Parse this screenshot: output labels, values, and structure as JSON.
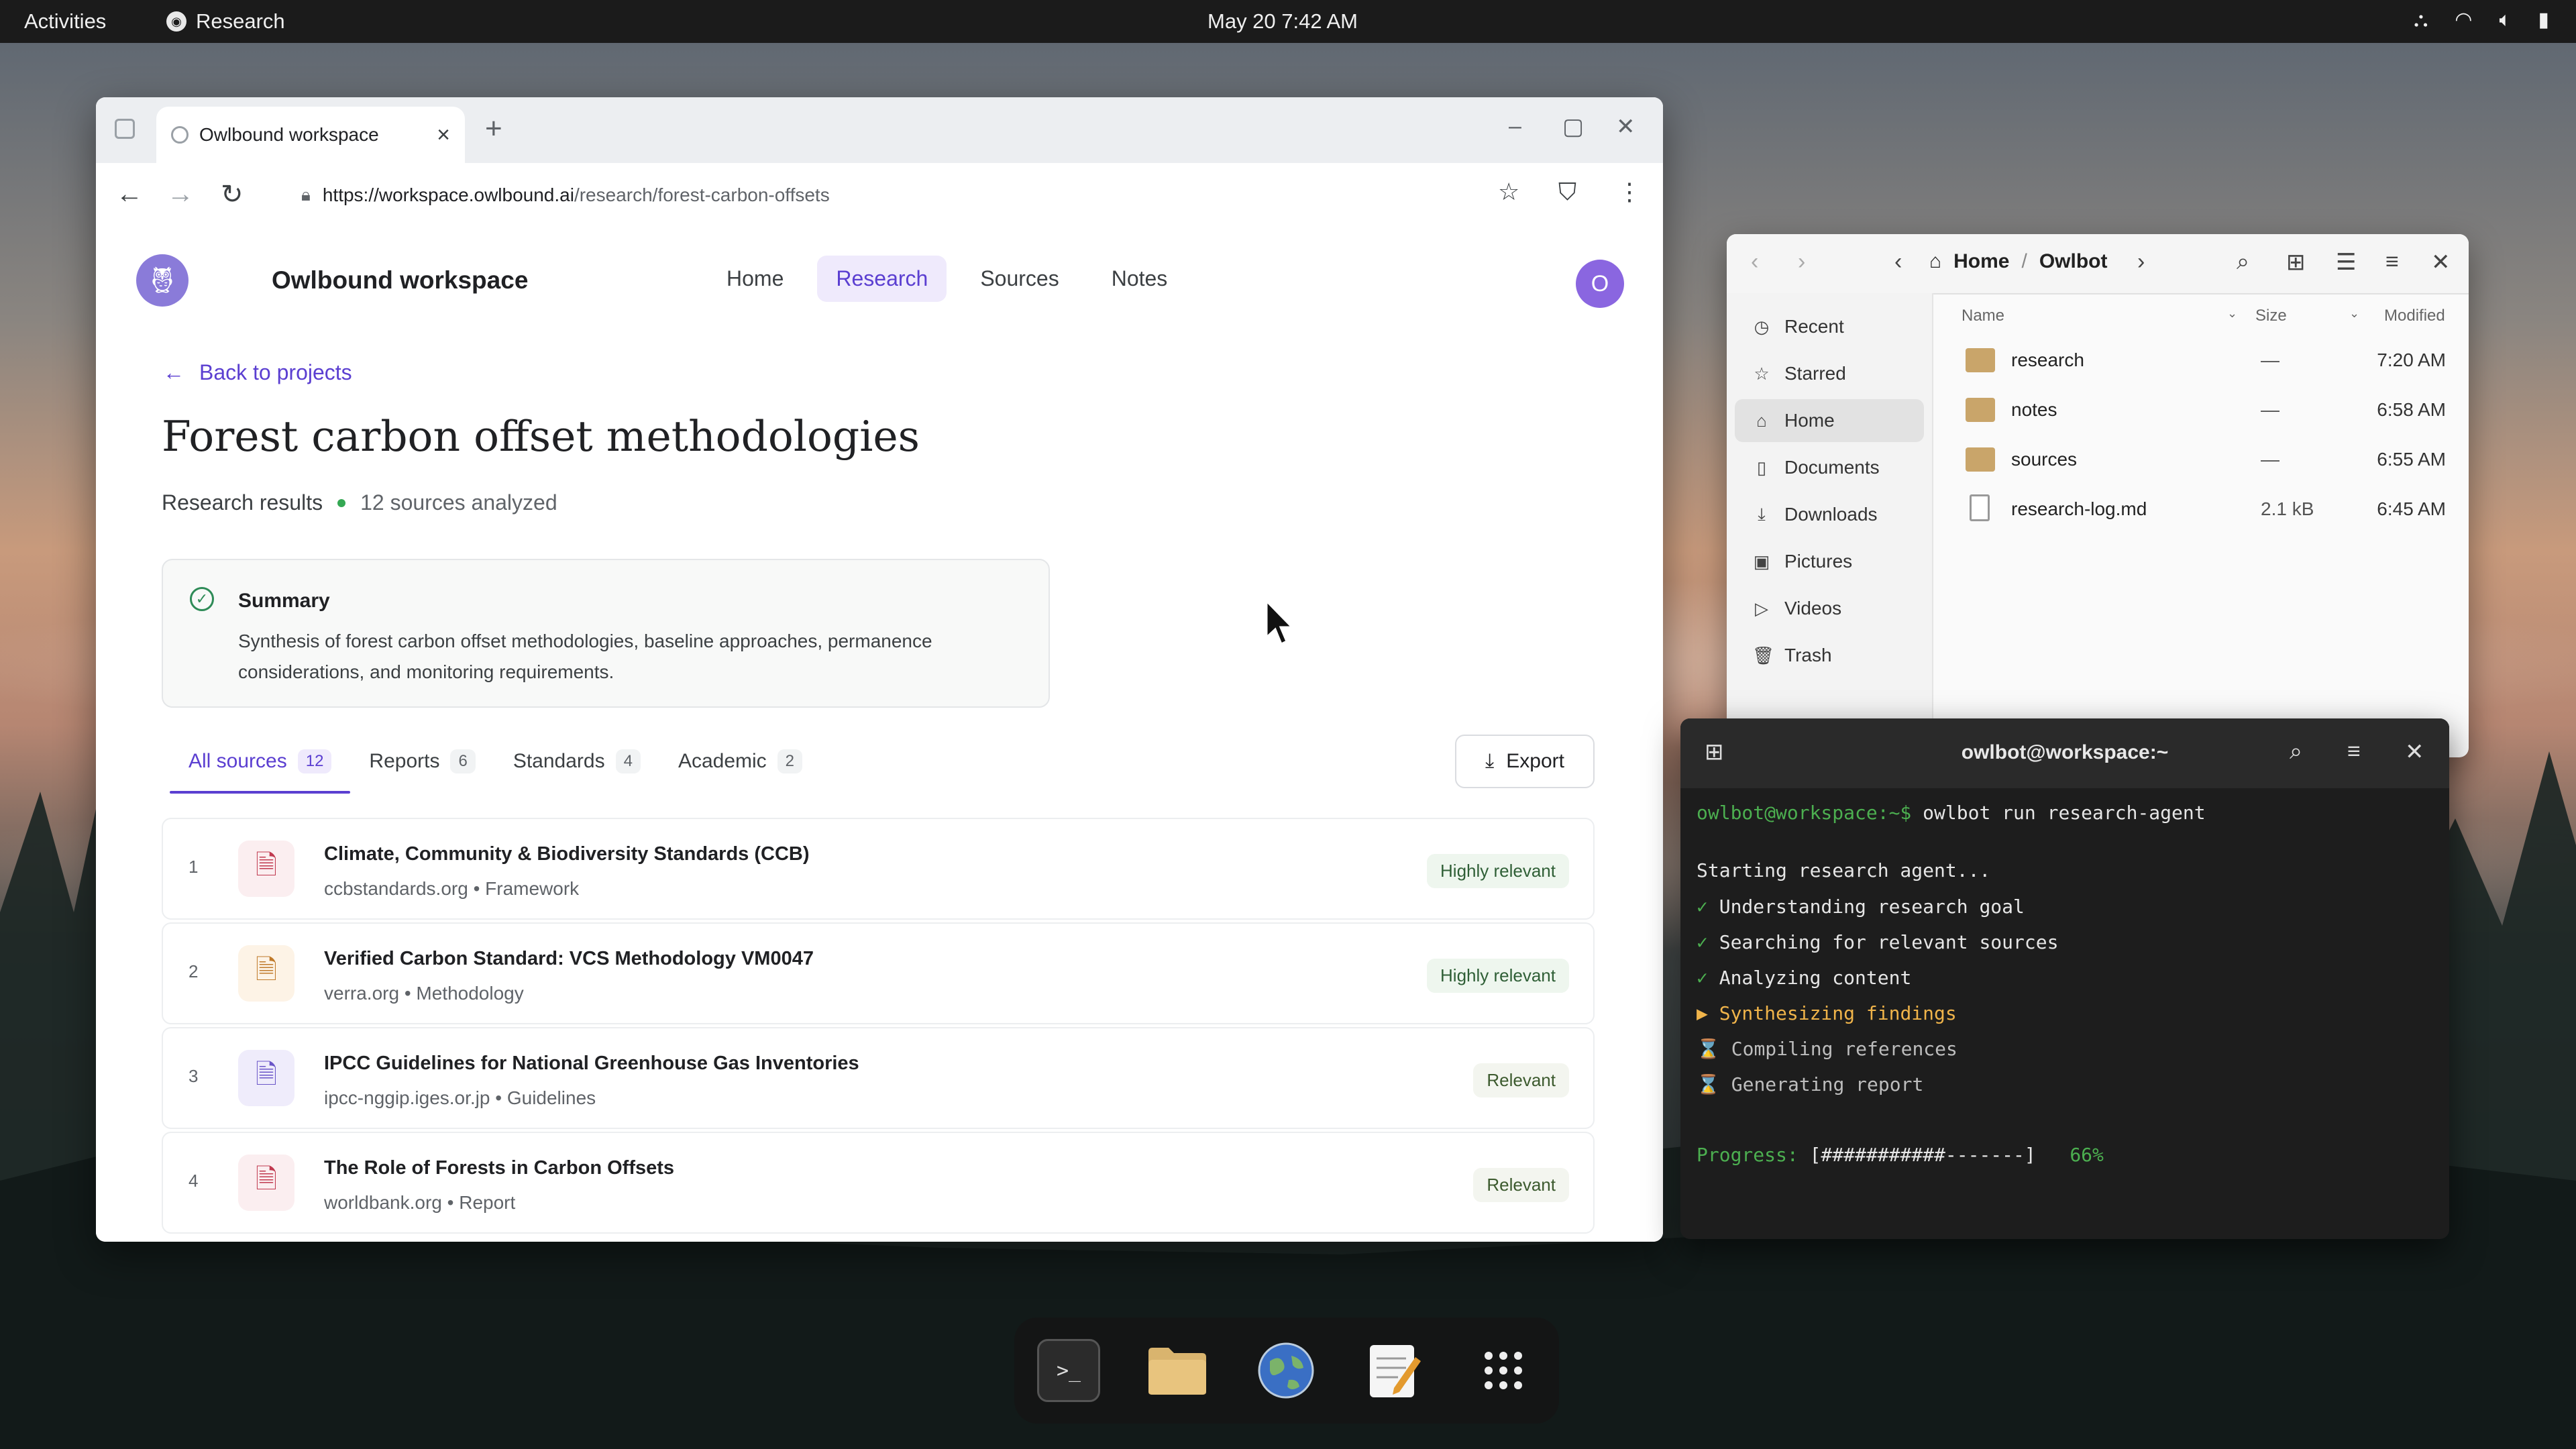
{
  "topbar": {
    "activities": "Activities",
    "app_name": "Research",
    "clock": "May 20  7:42 AM"
  },
  "browser": {
    "tab_title": "Owlbound workspace",
    "url_host": "https://workspace.owlbound.ai",
    "url_path": "/research/forest-carbon-offsets"
  },
  "site": {
    "brand": "Owlbound workspace",
    "nav": [
      "Home",
      "Research",
      "Sources",
      "Notes"
    ],
    "active_nav": "Research",
    "avatar_initial": "O",
    "back_label": "Back to projects",
    "title": "Forest carbon offset methodologies",
    "meta_label": "Research results",
    "meta_count": "12 sources analyzed",
    "summary_title": "Summary",
    "summary_text": "Synthesis of forest carbon offset methodologies, baseline approaches, permanence considerations, and monitoring requirements.",
    "filters": [
      {
        "label": "All sources",
        "count": "12"
      },
      {
        "label": "Reports",
        "count": "6"
      },
      {
        "label": "Standards",
        "count": "4"
      },
      {
        "label": "Academic",
        "count": "2"
      }
    ],
    "export_label": "Export",
    "sources": [
      {
        "num": "1",
        "title": "Climate, Community & Biodiversity Standards (CCB)",
        "sub": "ccbstandards.org • Framework",
        "relevance": "Highly relevant"
      },
      {
        "num": "2",
        "title": "Verified Carbon Standard: VCS Methodology VM0047",
        "sub": "verra.org • Methodology",
        "relevance": "Highly relevant"
      },
      {
        "num": "3",
        "title": "IPCC Guidelines for National Greenhouse Gas Inventories",
        "sub": "ipcc-nggip.iges.or.jp • Guidelines",
        "relevance": "Relevant"
      },
      {
        "num": "4",
        "title": "The Role of Forests in Carbon Offsets",
        "sub": "worldbank.org • Report",
        "relevance": "Relevant"
      }
    ]
  },
  "files": {
    "crumb_home": "Home",
    "crumb_current": "Owlbot",
    "sidebar": [
      "Recent",
      "Starred",
      "Home",
      "Documents",
      "Downloads",
      "Pictures",
      "Videos",
      "Trash"
    ],
    "columns": {
      "name": "Name",
      "size": "Size",
      "modified": "Modified"
    },
    "rows": [
      {
        "name": "research",
        "size": "—",
        "modified": "7:20 AM",
        "kind": "folder"
      },
      {
        "name": "notes",
        "size": "—",
        "modified": "6:58 AM",
        "kind": "folder"
      },
      {
        "name": "sources",
        "size": "—",
        "modified": "6:55 AM",
        "kind": "folder"
      },
      {
        "name": "research-log.md",
        "size": "2.1 kB",
        "modified": "6:45 AM",
        "kind": "file"
      }
    ]
  },
  "terminal": {
    "title": "owlbot@workspace:~",
    "prompt": "owlbot@workspace:~$",
    "command": " owlbot run research-agent",
    "starting": "Starting research agent...",
    "steps": [
      {
        "mark": "✓",
        "text": "Understanding research goal",
        "state": "done"
      },
      {
        "mark": "✓",
        "text": "Searching for relevant sources",
        "state": "done"
      },
      {
        "mark": "✓",
        "text": "Analyzing content",
        "state": "done"
      },
      {
        "mark": "▶",
        "text": "Synthesizing findings",
        "state": "active"
      },
      {
        "mark": "⌛",
        "text": "Compiling references",
        "state": "pending"
      },
      {
        "mark": "⌛",
        "text": "Generating report",
        "state": "pending"
      }
    ],
    "progress_label": "Progress:",
    "progress_bar": "[###########-------]",
    "progress_pct": "66%"
  },
  "colors": {
    "accent": "#5b3fd1",
    "success": "#4caf50",
    "warning": "#f0b44a"
  }
}
